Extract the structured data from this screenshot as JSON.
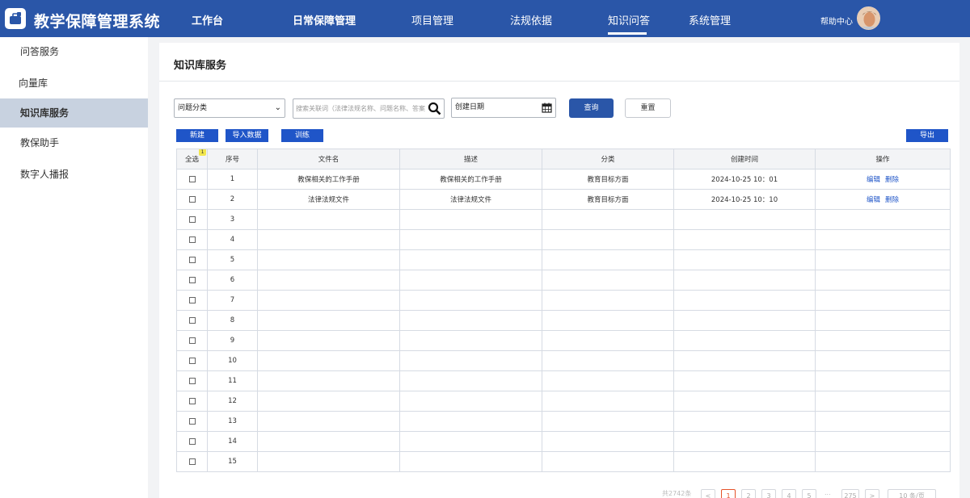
{
  "header": {
    "app_title": "教学保障管理系统",
    "nav": [
      {
        "label": "工作台"
      },
      {
        "label": "日常保障管理"
      },
      {
        "label": "项目管理"
      },
      {
        "label": "法规依据"
      },
      {
        "label": "知识问答"
      },
      {
        "label": "系统管理"
      }
    ],
    "active_nav": "知识问答",
    "help_label": "帮助中心",
    "brand_color": "#2a56a8"
  },
  "sidebar": {
    "items": [
      {
        "label": "问答服务"
      },
      {
        "label": "向量库"
      },
      {
        "label": "知识库服务"
      },
      {
        "label": "教保助手"
      },
      {
        "label": "数字人播报"
      }
    ],
    "active": "知识库服务"
  },
  "page": {
    "title": "知识库服务"
  },
  "filters": {
    "category_select": "问题分类",
    "search_placeholder": "搜索关联词（法律法规名称、问题名称、答案",
    "date_placeholder": "创建日期",
    "query_label": "查询",
    "reset_label": "重置"
  },
  "toolbar": {
    "new_label": "新建",
    "import_label": "导入数据",
    "train_label": "训练",
    "export_label": "导出"
  },
  "table": {
    "headers": [
      "全选",
      "序号",
      "文件名",
      "描述",
      "分类",
      "创建时间",
      "操作"
    ],
    "select_badge": "1",
    "rows": [
      {
        "index": "1",
        "filename": "教保相关的工作手册",
        "desc": "教保相关的工作手册",
        "category": "教育目标方面",
        "created": "2024-10-25 10：01",
        "edit": "编辑",
        "delete": "删除"
      },
      {
        "index": "2",
        "filename": "法律法规文件",
        "desc": "法律法规文件",
        "category": "教育目标方面",
        "created": "2024-10-25 10：10",
        "edit": "编辑",
        "delete": "删除"
      },
      {
        "index": "3",
        "filename": "",
        "desc": "",
        "category": "",
        "created": "",
        "edit": "",
        "delete": ""
      },
      {
        "index": "4",
        "filename": "",
        "desc": "",
        "category": "",
        "created": "",
        "edit": "",
        "delete": ""
      },
      {
        "index": "5",
        "filename": "",
        "desc": "",
        "category": "",
        "created": "",
        "edit": "",
        "delete": ""
      },
      {
        "index": "6",
        "filename": "",
        "desc": "",
        "category": "",
        "created": "",
        "edit": "",
        "delete": ""
      },
      {
        "index": "7",
        "filename": "",
        "desc": "",
        "category": "",
        "created": "",
        "edit": "",
        "delete": ""
      },
      {
        "index": "8",
        "filename": "",
        "desc": "",
        "category": "",
        "created": "",
        "edit": "",
        "delete": ""
      },
      {
        "index": "9",
        "filename": "",
        "desc": "",
        "category": "",
        "created": "",
        "edit": "",
        "delete": ""
      },
      {
        "index": "10",
        "filename": "",
        "desc": "",
        "category": "",
        "created": "",
        "edit": "",
        "delete": ""
      },
      {
        "index": "11",
        "filename": "",
        "desc": "",
        "category": "",
        "created": "",
        "edit": "",
        "delete": ""
      },
      {
        "index": "12",
        "filename": "",
        "desc": "",
        "category": "",
        "created": "",
        "edit": "",
        "delete": ""
      },
      {
        "index": "13",
        "filename": "",
        "desc": "",
        "category": "",
        "created": "",
        "edit": "",
        "delete": ""
      },
      {
        "index": "14",
        "filename": "",
        "desc": "",
        "category": "",
        "created": "",
        "edit": "",
        "delete": ""
      },
      {
        "index": "15",
        "filename": "",
        "desc": "",
        "category": "",
        "created": "",
        "edit": "",
        "delete": ""
      }
    ]
  },
  "pagination": {
    "total_label": "共2742条",
    "prev": "<",
    "pages": [
      "1",
      "2",
      "3",
      "4",
      "5",
      "...",
      "275"
    ],
    "current": "1",
    "next": ">",
    "page_size": "10 条/页"
  }
}
